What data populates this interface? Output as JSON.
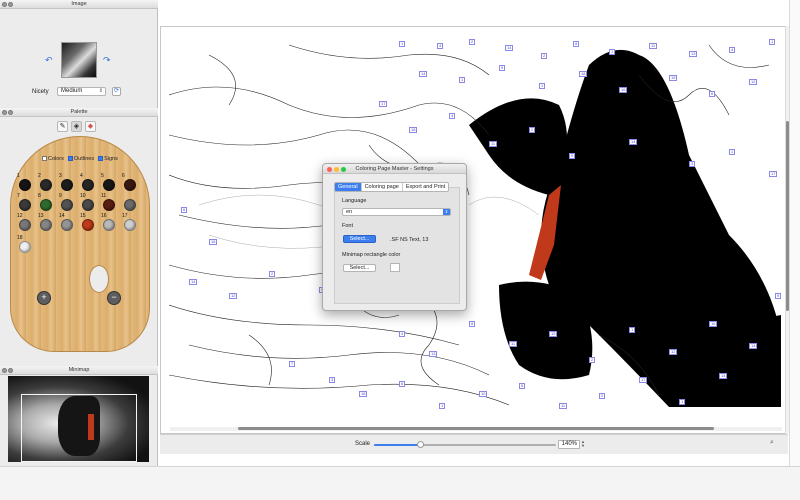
{
  "image_panel": {
    "title": "Image",
    "nicety_label": "Nicety",
    "nicety_value": "Medium"
  },
  "palette_panel": {
    "title": "Palette",
    "checks": [
      {
        "label": "Colors",
        "checked": false
      },
      {
        "label": "Outlines",
        "checked": true
      },
      {
        "label": "Signs",
        "checked": true
      }
    ],
    "swatches": [
      {
        "n": "1",
        "color": "#151515"
      },
      {
        "n": "2",
        "color": "#2a2a2a"
      },
      {
        "n": "3",
        "color": "#1d1d1d"
      },
      {
        "n": "4",
        "color": "#262626"
      },
      {
        "n": "5",
        "color": "#181818"
      },
      {
        "n": "6",
        "color": "#3a1a10"
      },
      {
        "n": "7",
        "color": "#3a3a3a"
      },
      {
        "n": "8",
        "color": "#2f6b2f"
      },
      {
        "n": "9",
        "color": "#525252"
      },
      {
        "n": "10",
        "color": "#4a4a4a"
      },
      {
        "n": "11",
        "color": "#5a1e12"
      },
      {
        "n": "",
        "color": "#6a6a6a"
      },
      {
        "n": "12",
        "color": "#777777"
      },
      {
        "n": "13",
        "color": "#858585"
      },
      {
        "n": "14",
        "color": "#949494"
      },
      {
        "n": "15",
        "color": "#c0391b"
      },
      {
        "n": "16",
        "color": "#b9b9b9"
      },
      {
        "n": "17",
        "color": "#cfcfcf"
      },
      {
        "n": "18",
        "color": "#efefef"
      }
    ],
    "add_label": "+",
    "remove_label": "−"
  },
  "minimap_panel": {
    "title": "Minimap"
  },
  "canvas": {
    "labels": [
      "1",
      "4",
      "2",
      "14",
      "2",
      "8",
      "1",
      "11",
      "13",
      "4",
      "1",
      "14",
      "1",
      "9",
      "1",
      "18",
      "16",
      "15",
      "6",
      "12",
      "17",
      "18",
      "4",
      "11",
      "2",
      "9",
      "14",
      "3",
      "1",
      "17",
      "6",
      "16",
      "14",
      "12",
      "2",
      "9",
      "1",
      "4",
      "13",
      "8",
      "11",
      "15",
      "2",
      "1",
      "12",
      "16",
      "14",
      "9",
      "7",
      "3",
      "18",
      "6",
      "1",
      "10",
      "5",
      "11",
      "2",
      "17",
      "1",
      "14"
    ]
  },
  "bottom_bar": {
    "scale_label": "Scale",
    "scale_value": "140%",
    "scale_fraction": 0.25
  },
  "settings_dialog": {
    "title": "Coloring Page Master - Settings",
    "tabs": [
      {
        "label": "General",
        "active": true
      },
      {
        "label": "Coloring page",
        "active": false
      },
      {
        "label": "Export and Print",
        "active": false
      }
    ],
    "language_label": "Language",
    "language_value": "en",
    "font_label": "Font",
    "font_button": "Select...",
    "font_value": ".SF NS Text, 13",
    "minimap_color_label": "Minimap rectangle color",
    "minimap_color_button": "Select..."
  },
  "colors": {
    "accent": "#3c7ef0",
    "highlight_red": "#c0391b",
    "traffic_close": "#ff5f57",
    "traffic_min": "#febc2e",
    "traffic_max": "#28c840"
  }
}
